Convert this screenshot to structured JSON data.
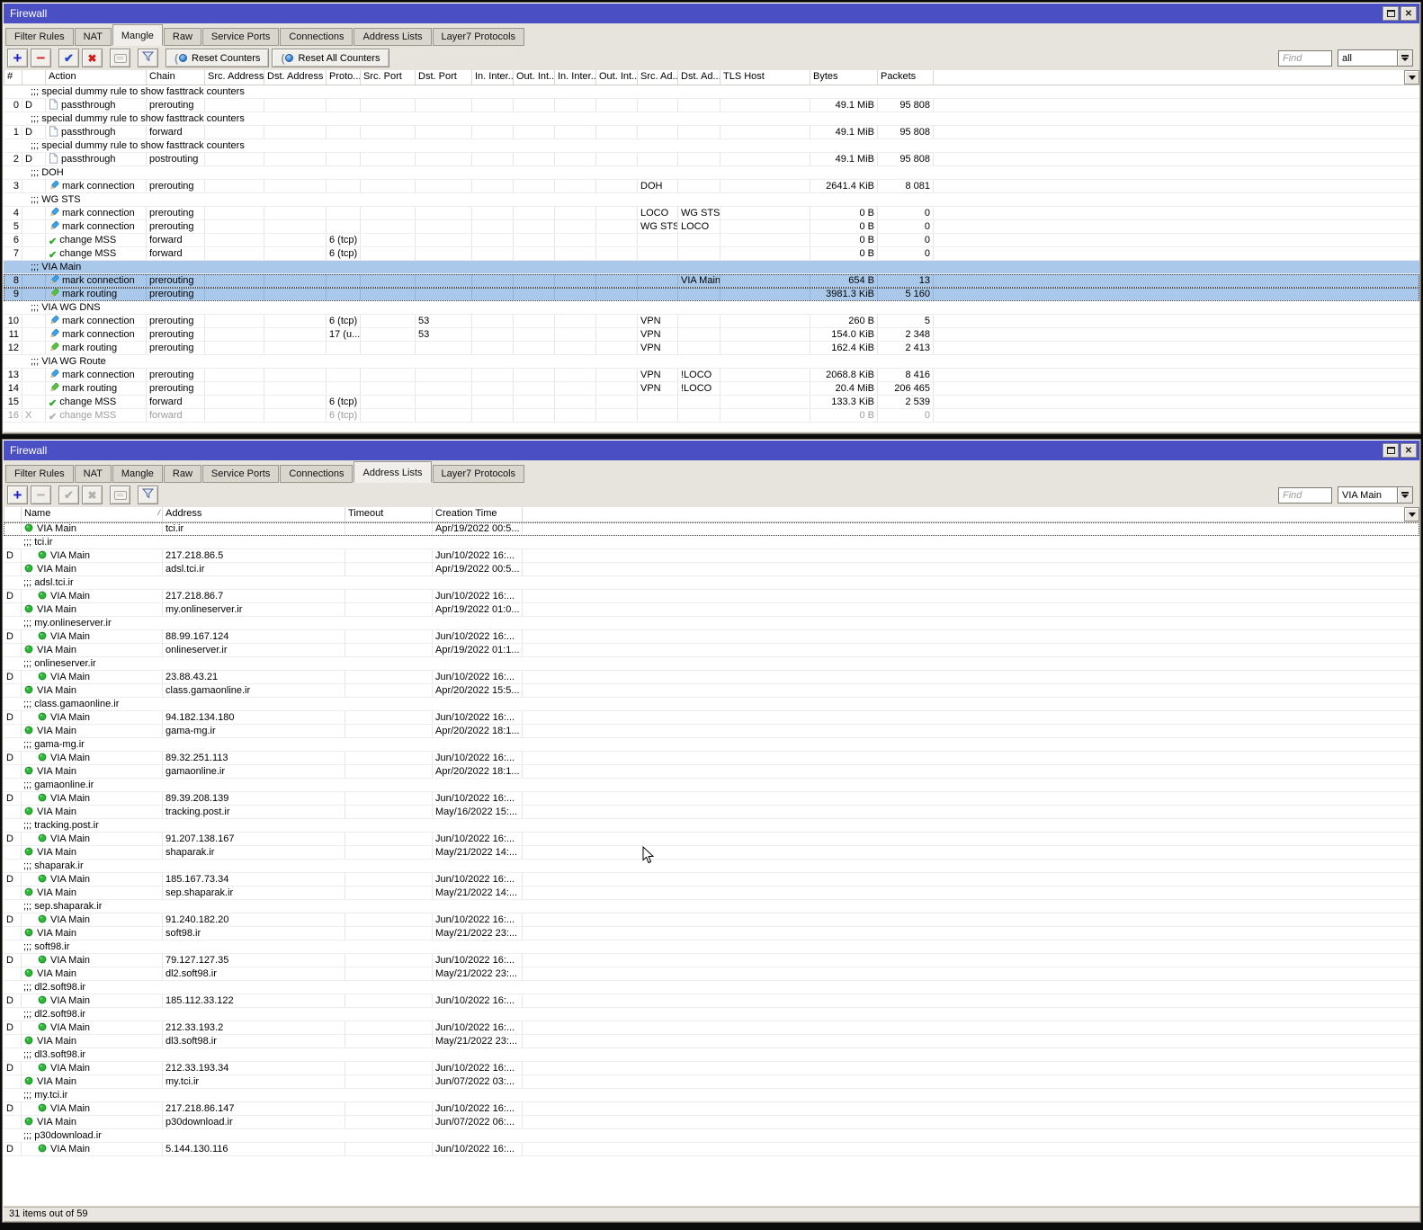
{
  "colors": {
    "titlebar": "#4a50c4",
    "selection_blue": "#a9c8ea",
    "dynamic_entry_green": "#2cb838",
    "accent_blue": "#2443cc",
    "accent_red": "#cc2020"
  },
  "mangle_window": {
    "title": "Firewall",
    "tabs": [
      "Filter Rules",
      "NAT",
      "Mangle",
      "Raw",
      "Service Ports",
      "Connections",
      "Address Lists",
      "Layer7 Protocols"
    ],
    "active_tab": "Mangle",
    "buttons": {
      "reset_counters": "Reset Counters",
      "reset_all_counters": "Reset All Counters"
    },
    "find_placeholder": "Find",
    "filter_scope": "all",
    "columns": [
      "#",
      "",
      "Action",
      "Chain",
      "Src. Address",
      "Dst. Address",
      "Proto...",
      "Src. Port",
      "Dst. Port",
      "In. Inter...",
      "Out. Int...",
      "In. Inter...",
      "Out. Int...",
      "Src. Ad...",
      "Dst. Ad...",
      "TLS Host",
      "Bytes",
      "Packets"
    ],
    "rows": [
      {
        "t": "c",
        "text": ";;; special dummy rule to show fasttrack counters"
      },
      {
        "t": "r",
        "n": "0",
        "flag": "D",
        "icon": "doc",
        "action": "passthrough",
        "chain": "prerouting",
        "bytes": "49.1 MiB",
        "packets": "95 808"
      },
      {
        "t": "c",
        "text": ";;; special dummy rule to show fasttrack counters"
      },
      {
        "t": "r",
        "n": "1",
        "flag": "D",
        "icon": "doc",
        "action": "passthrough",
        "chain": "forward",
        "bytes": "49.1 MiB",
        "packets": "95 808"
      },
      {
        "t": "c",
        "text": ";;; special dummy rule to show fasttrack counters"
      },
      {
        "t": "r",
        "n": "2",
        "flag": "D",
        "icon": "doc",
        "action": "passthrough",
        "chain": "postrouting",
        "bytes": "49.1 MiB",
        "packets": "95 808"
      },
      {
        "t": "c",
        "text": ";;; DOH"
      },
      {
        "t": "r",
        "n": "3",
        "icon": "pen-blue",
        "action": "mark connection",
        "chain": "prerouting",
        "srcad": "DOH",
        "bytes": "2641.4 KiB",
        "packets": "8 081"
      },
      {
        "t": "c",
        "text": ";;; WG STS"
      },
      {
        "t": "r",
        "n": "4",
        "icon": "pen-blue",
        "action": "mark connection",
        "chain": "prerouting",
        "srcad": "LOCO",
        "dstad": "WG STS",
        "bytes": "0 B",
        "packets": "0"
      },
      {
        "t": "r",
        "n": "5",
        "icon": "pen-blue",
        "action": "mark connection",
        "chain": "prerouting",
        "srcad": "WG STS",
        "dstad": "LOCO",
        "bytes": "0 B",
        "packets": "0"
      },
      {
        "t": "r",
        "n": "6",
        "icon": "check",
        "action": "change MSS",
        "chain": "forward",
        "proto": "6 (tcp)",
        "bytes": "0 B",
        "packets": "0"
      },
      {
        "t": "r",
        "n": "7",
        "icon": "check",
        "action": "change MSS",
        "chain": "forward",
        "proto": "6 (tcp)",
        "bytes": "0 B",
        "packets": "0"
      },
      {
        "t": "c",
        "text": ";;; VIA Main",
        "sel": true
      },
      {
        "t": "r",
        "n": "8",
        "icon": "pen-blue",
        "action": "mark connection",
        "chain": "prerouting",
        "dstad": "VIA Main",
        "bytes": "654 B",
        "packets": "13",
        "sel": true,
        "foc": true
      },
      {
        "t": "r",
        "n": "9",
        "icon": "pen-green",
        "action": "mark routing",
        "chain": "prerouting",
        "bytes": "3981.3 KiB",
        "packets": "5 160",
        "sel": true,
        "foc": true
      },
      {
        "t": "c",
        "text": ";;; VIA WG DNS"
      },
      {
        "t": "r",
        "n": "10",
        "icon": "pen-blue",
        "action": "mark connection",
        "chain": "prerouting",
        "proto": "6 (tcp)",
        "dstport": "53",
        "srcad": "VPN",
        "bytes": "260 B",
        "packets": "5"
      },
      {
        "t": "r",
        "n": "11",
        "icon": "pen-blue",
        "action": "mark connection",
        "chain": "prerouting",
        "proto": "17 (u...",
        "dstport": "53",
        "srcad": "VPN",
        "bytes": "154.0 KiB",
        "packets": "2 348"
      },
      {
        "t": "r",
        "n": "12",
        "icon": "pen-green",
        "action": "mark routing",
        "chain": "prerouting",
        "srcad": "VPN",
        "bytes": "162.4 KiB",
        "packets": "2 413"
      },
      {
        "t": "c",
        "text": ";;; VIA WG Route"
      },
      {
        "t": "r",
        "n": "13",
        "icon": "pen-blue",
        "action": "mark connection",
        "chain": "prerouting",
        "srcad": "VPN",
        "dstad": "!LOCO",
        "bytes": "2068.8 KiB",
        "packets": "8 416"
      },
      {
        "t": "r",
        "n": "14",
        "icon": "pen-green",
        "action": "mark routing",
        "chain": "prerouting",
        "srcad": "VPN",
        "dstad": "!LOCO",
        "bytes": "20.4 MiB",
        "packets": "206 465"
      },
      {
        "t": "r",
        "n": "15",
        "icon": "check",
        "action": "change MSS",
        "chain": "forward",
        "proto": "6 (tcp)",
        "bytes": "133.3 KiB",
        "packets": "2 539"
      },
      {
        "t": "r",
        "n": "16",
        "flag": "X",
        "icon": "check-dis",
        "action": "change MSS",
        "chain": "forward",
        "proto": "6 (tcp)",
        "bytes": "0 B",
        "packets": "0",
        "dis": true
      }
    ]
  },
  "address_window": {
    "title": "Firewall",
    "tabs": [
      "Filter Rules",
      "NAT",
      "Mangle",
      "Raw",
      "Service Ports",
      "Connections",
      "Address Lists",
      "Layer7 Protocols"
    ],
    "active_tab": "Address Lists",
    "find_placeholder": "Find",
    "list_filter": "VIA Main",
    "columns": [
      "",
      "Name",
      "Address",
      "Timeout",
      "Creation Time"
    ],
    "status": "31 items out of 59",
    "rows": [
      {
        "t": "i",
        "name": "VIA Main",
        "address": "tci.ir",
        "created": "Apr/19/2022 00:5...",
        "foc": true
      },
      {
        "t": "c",
        "text": ";;; tci.ir"
      },
      {
        "t": "i",
        "flag": "D",
        "name": "VIA Main",
        "address": "217.218.86.5",
        "created": "Jun/10/2022 16:..."
      },
      {
        "t": "i",
        "name": "VIA Main",
        "address": "adsl.tci.ir",
        "created": "Apr/19/2022 00:5..."
      },
      {
        "t": "c",
        "text": ";;; adsl.tci.ir"
      },
      {
        "t": "i",
        "flag": "D",
        "name": "VIA Main",
        "address": "217.218.86.7",
        "created": "Jun/10/2022 16:..."
      },
      {
        "t": "i",
        "name": "VIA Main",
        "address": "my.onlineserver.ir",
        "created": "Apr/19/2022 01:0..."
      },
      {
        "t": "c",
        "text": ";;; my.onlineserver.ir"
      },
      {
        "t": "i",
        "flag": "D",
        "name": "VIA Main",
        "address": "88.99.167.124",
        "created": "Jun/10/2022 16:..."
      },
      {
        "t": "i",
        "name": "VIA Main",
        "address": "onlineserver.ir",
        "created": "Apr/19/2022 01:1..."
      },
      {
        "t": "c",
        "text": ";;; onlineserver.ir"
      },
      {
        "t": "i",
        "flag": "D",
        "name": "VIA Main",
        "address": "23.88.43.21",
        "created": "Jun/10/2022 16:..."
      },
      {
        "t": "i",
        "name": "VIA Main",
        "address": "class.gamaonline.ir",
        "created": "Apr/20/2022 15:5..."
      },
      {
        "t": "c",
        "text": ";;; class.gamaonline.ir"
      },
      {
        "t": "i",
        "flag": "D",
        "name": "VIA Main",
        "address": "94.182.134.180",
        "created": "Jun/10/2022 16:..."
      },
      {
        "t": "i",
        "name": "VIA Main",
        "address": "gama-mg.ir",
        "created": "Apr/20/2022 18:1..."
      },
      {
        "t": "c",
        "text": ";;; gama-mg.ir"
      },
      {
        "t": "i",
        "flag": "D",
        "name": "VIA Main",
        "address": "89.32.251.113",
        "created": "Jun/10/2022 16:..."
      },
      {
        "t": "i",
        "name": "VIA Main",
        "address": "gamaonline.ir",
        "created": "Apr/20/2022 18:1..."
      },
      {
        "t": "c",
        "text": ";;; gamaonline.ir"
      },
      {
        "t": "i",
        "flag": "D",
        "name": "VIA Main",
        "address": "89.39.208.139",
        "created": "Jun/10/2022 16:..."
      },
      {
        "t": "i",
        "name": "VIA Main",
        "address": "tracking.post.ir",
        "created": "May/16/2022 15:..."
      },
      {
        "t": "c",
        "text": ";;; tracking.post.ir"
      },
      {
        "t": "i",
        "flag": "D",
        "name": "VIA Main",
        "address": "91.207.138.167",
        "created": "Jun/10/2022 16:..."
      },
      {
        "t": "i",
        "name": "VIA Main",
        "address": "shaparak.ir",
        "created": "May/21/2022 14:..."
      },
      {
        "t": "c",
        "text": ";;; shaparak.ir"
      },
      {
        "t": "i",
        "flag": "D",
        "name": "VIA Main",
        "address": "185.167.73.34",
        "created": "Jun/10/2022 16:..."
      },
      {
        "t": "i",
        "name": "VIA Main",
        "address": "sep.shaparak.ir",
        "created": "May/21/2022 14:..."
      },
      {
        "t": "c",
        "text": ";;; sep.shaparak.ir"
      },
      {
        "t": "i",
        "flag": "D",
        "name": "VIA Main",
        "address": "91.240.182.20",
        "created": "Jun/10/2022 16:..."
      },
      {
        "t": "i",
        "name": "VIA Main",
        "address": "soft98.ir",
        "created": "May/21/2022 23:..."
      },
      {
        "t": "c",
        "text": ";;; soft98.ir"
      },
      {
        "t": "i",
        "flag": "D",
        "name": "VIA Main",
        "address": "79.127.127.35",
        "created": "Jun/10/2022 16:..."
      },
      {
        "t": "i",
        "name": "VIA Main",
        "address": "dl2.soft98.ir",
        "created": "May/21/2022 23:..."
      },
      {
        "t": "c",
        "text": ";;; dl2.soft98.ir"
      },
      {
        "t": "i",
        "flag": "D",
        "name": "VIA Main",
        "address": "185.112.33.122",
        "created": "Jun/10/2022 16:..."
      },
      {
        "t": "c",
        "text": ";;; dl2.soft98.ir"
      },
      {
        "t": "i",
        "flag": "D",
        "name": "VIA Main",
        "address": "212.33.193.2",
        "created": "Jun/10/2022 16:..."
      },
      {
        "t": "i",
        "name": "VIA Main",
        "address": "dl3.soft98.ir",
        "created": "May/21/2022 23:..."
      },
      {
        "t": "c",
        "text": ";;; dl3.soft98.ir"
      },
      {
        "t": "i",
        "flag": "D",
        "name": "VIA Main",
        "address": "212.33.193.34",
        "created": "Jun/10/2022 16:..."
      },
      {
        "t": "i",
        "name": "VIA Main",
        "address": "my.tci.ir",
        "created": "Jun/07/2022 03:..."
      },
      {
        "t": "c",
        "text": ";;; my.tci.ir"
      },
      {
        "t": "i",
        "flag": "D",
        "name": "VIA Main",
        "address": "217.218.86.147",
        "created": "Jun/10/2022 16:..."
      },
      {
        "t": "i",
        "name": "VIA Main",
        "address": "p30download.ir",
        "created": "Jun/07/2022 06:..."
      },
      {
        "t": "c",
        "text": ";;; p30download.ir"
      },
      {
        "t": "i",
        "flag": "D",
        "name": "VIA Main",
        "address": "5.144.130.116",
        "created": "Jun/10/2022 16:..."
      }
    ]
  }
}
